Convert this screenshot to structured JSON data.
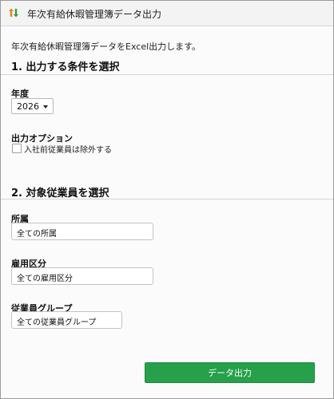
{
  "window": {
    "title": "年次有給休暇管理簿データ出力",
    "app_icon": "sort-arrows-icon"
  },
  "description": "年次有給休暇管理簿データをExcel出力します。",
  "section1": {
    "title": "1. 出力する条件を選択",
    "year": {
      "label": "年度",
      "value": "2026"
    },
    "output_option": {
      "label": "出力オプション",
      "checkbox_label": "入社前従業員は除外する",
      "checked": false
    }
  },
  "section2": {
    "title": "2. 対象従業員を選択",
    "department": {
      "label": "所属",
      "value": "全ての所属"
    },
    "employment_type": {
      "label": "雇用区分",
      "value": "全ての雇用区分"
    },
    "employee_group": {
      "label": "従業員グループ",
      "value": "全ての従業員グループ"
    }
  },
  "footer": {
    "export_label": "データ出力"
  },
  "colors": {
    "primary_button": "#26a04a",
    "app_icon_orange": "#e8821e",
    "app_icon_green": "#2e9b46"
  }
}
